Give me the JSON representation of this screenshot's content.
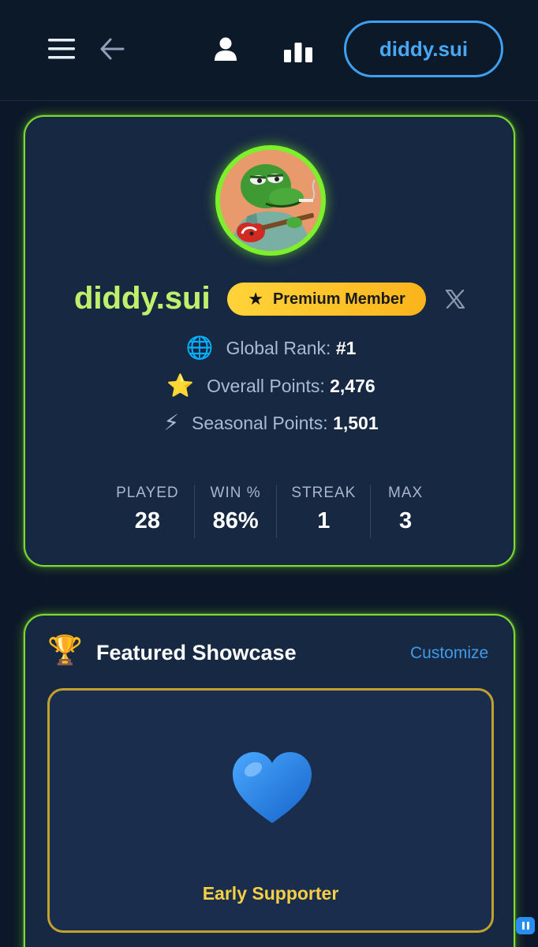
{
  "header": {
    "menu_icon": "hamburger-menu-icon",
    "back_icon": "arrow-left-icon",
    "profile_icon": "user-icon",
    "stats_icon": "bar-chart-icon",
    "username_button": "diddy.sui"
  },
  "profile": {
    "username": "diddy.sui",
    "badge_label": "Premium Member",
    "badge_icon": "star-icon",
    "social_icon": "x-logo-icon",
    "global_rank_label": "Global Rank:",
    "global_rank_value": "#1",
    "global_rank_emoji": "🌐",
    "overall_points_label": "Overall Points:",
    "overall_points_value": "2,476",
    "overall_points_emoji": "⭐",
    "seasonal_points_label": "Seasonal Points:",
    "seasonal_points_value": "1,501",
    "seasonal_points_emoji": "⚡",
    "stats": [
      {
        "label": "PLAYED",
        "value": "28"
      },
      {
        "label": "WIN %",
        "value": "86%"
      },
      {
        "label": "STREAK",
        "value": "1"
      },
      {
        "label": "MAX",
        "value": "3"
      }
    ]
  },
  "showcase": {
    "trophy_emoji": "🏆",
    "title": "Featured Showcase",
    "customize_label": "Customize",
    "item_icon": "blue-heart-icon",
    "item_name": "Early Supporter"
  },
  "colors": {
    "accent_green": "#7cdc2e",
    "accent_blue": "#3ea0f2",
    "premium_gold": "#fbb41b",
    "showcase_gold": "#c3a12f",
    "card_bg": "#172842",
    "page_bg": "#0c1829"
  }
}
